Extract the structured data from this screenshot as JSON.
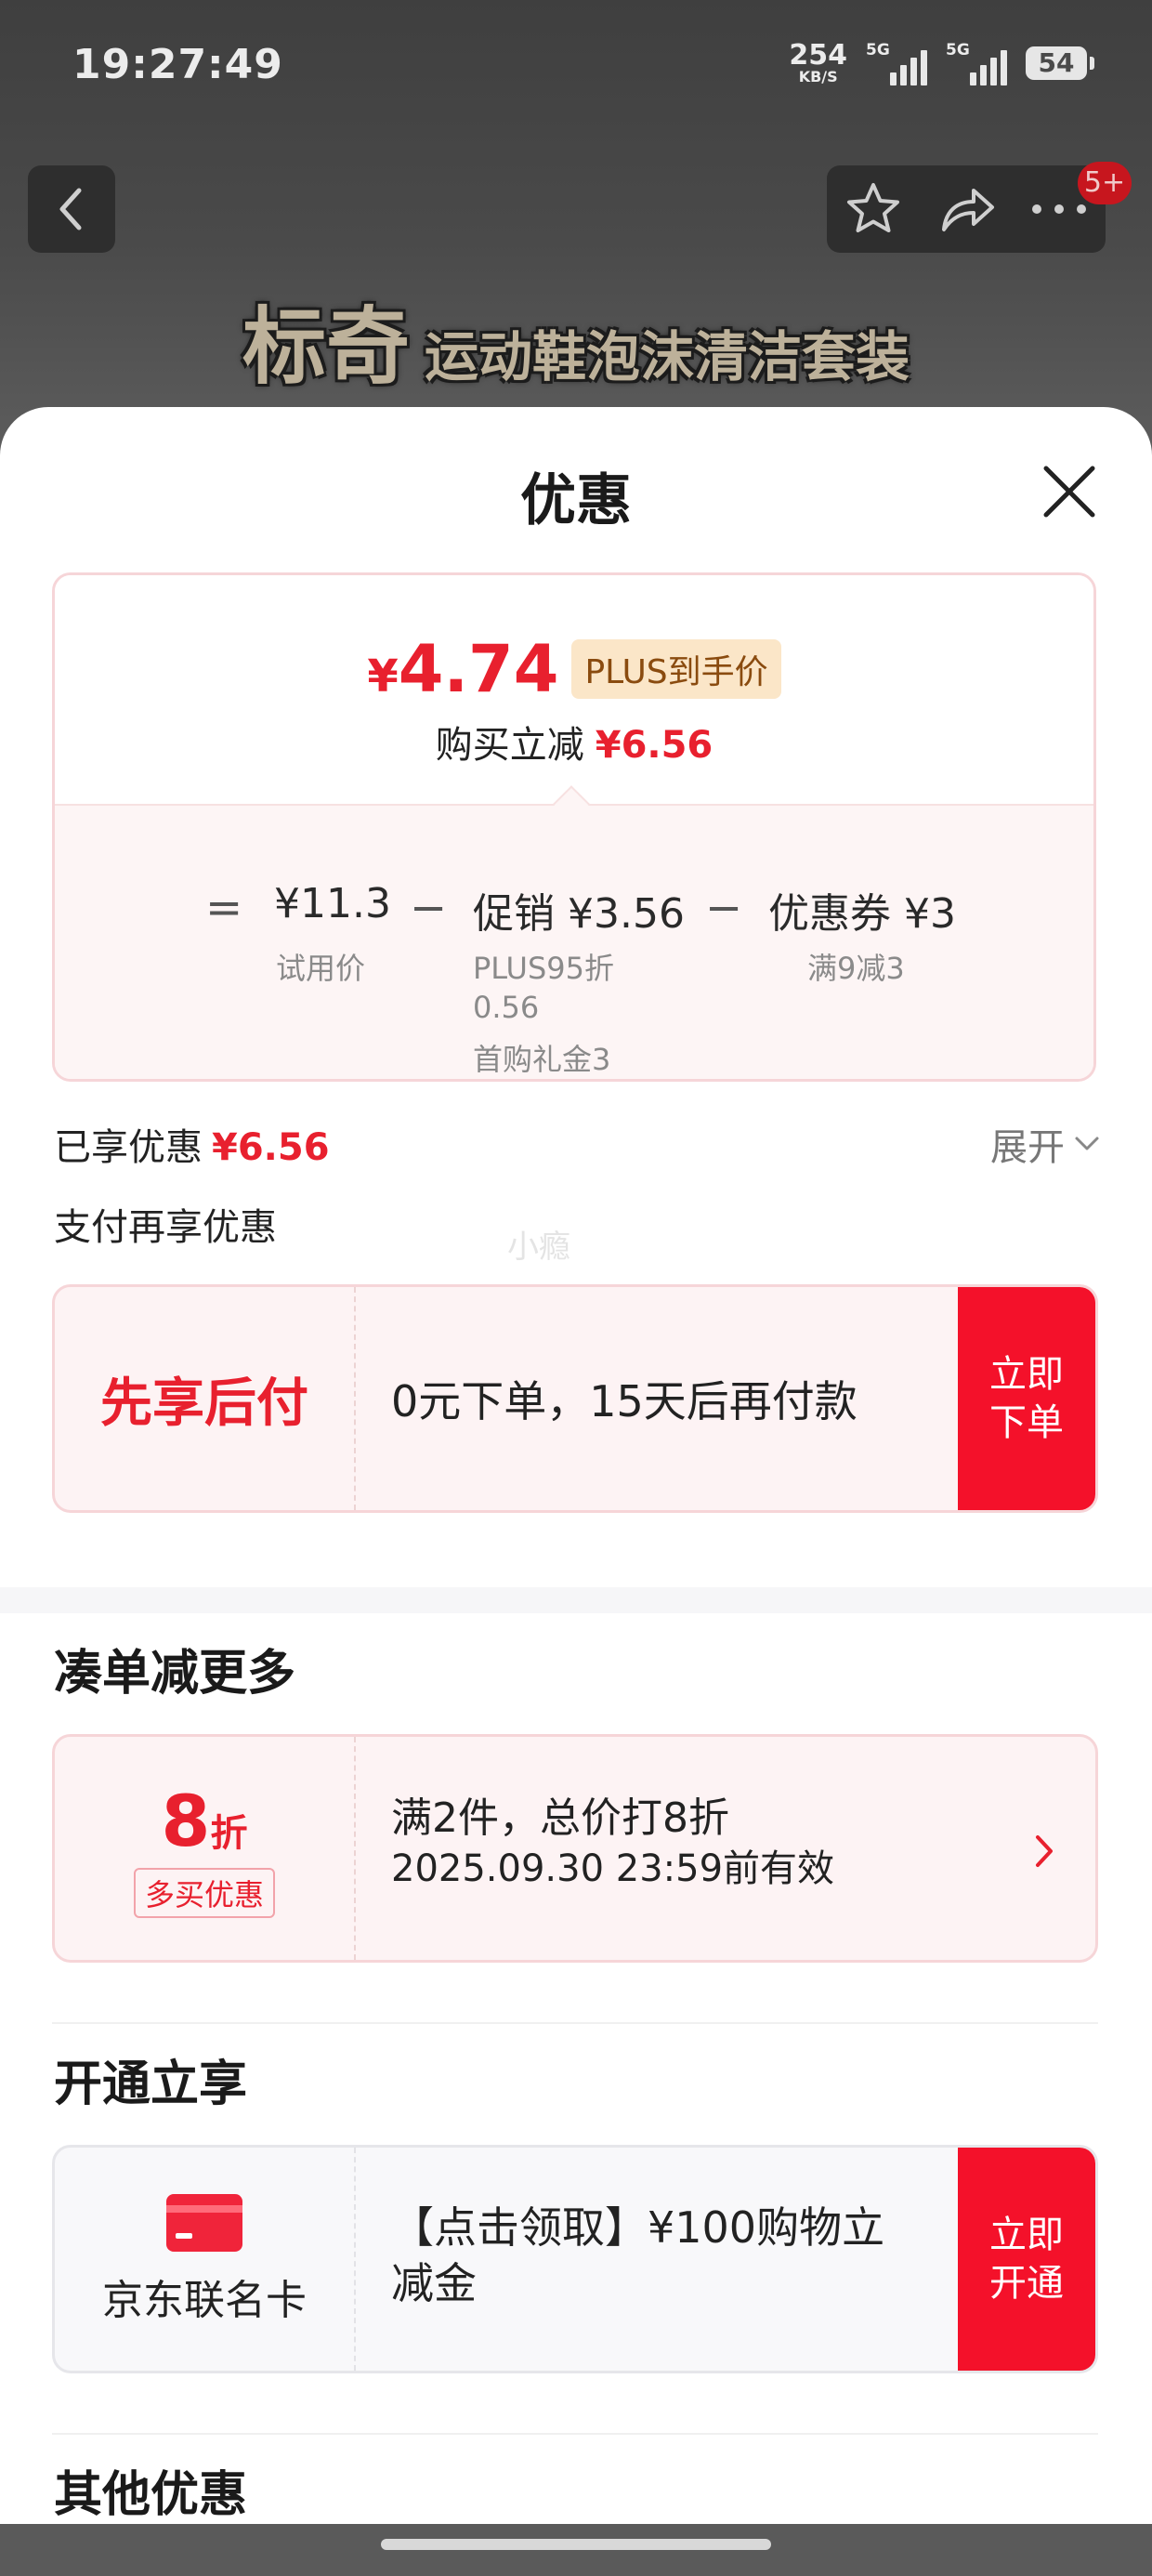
{
  "status_bar": {
    "time": "19:27:49",
    "net_speed_value": "254",
    "net_speed_unit": "KB/S",
    "signal1_tag": "5G",
    "signal2_tag": "5G",
    "battery": "54"
  },
  "header": {
    "message_badge": "5+",
    "banner_brand": "标奇",
    "banner_rest": "运动鞋泡沫清洁套装"
  },
  "sheet": {
    "title": "优惠",
    "final_price_currency": "¥",
    "final_price_value": "4.74",
    "plus_tag": "PLUS到手价",
    "instant_label": "购买立减",
    "instant_amount": "¥6.56",
    "calc": {
      "eq": "=",
      "trial_price": "¥11.3",
      "trial_label": "试用价",
      "minus1": "−",
      "promo": "促销 ¥3.56",
      "promo_sub1": "PLUS95折",
      "promo_sub2": "0.56",
      "promo_sub3": "首购礼金3",
      "minus2": "−",
      "coupon": "优惠券 ¥3",
      "coupon_sub": "满9减3"
    },
    "enjoyed_label": "已享优惠",
    "enjoyed_amount": "¥6.56",
    "expand_label": "展开",
    "pay_more_label": "支付再享优惠",
    "watermark": "小瘾",
    "bnpl": {
      "title": "先享后付",
      "desc": "0元下单，15天后再付款",
      "btn_line1": "立即",
      "btn_line2": "下单"
    },
    "bundle_section_title": "凑单减更多",
    "bundle": {
      "discount_num": "8",
      "discount_unit": "折",
      "tag": "多买优惠",
      "line1": "满2件，总价打8折",
      "line2": "2025.09.30 23:59前有效"
    },
    "open_section_title": "开通立享",
    "card_offer": {
      "name": "京东联名卡",
      "desc": "【点击领取】¥100购物立减金",
      "btn_line1": "立即",
      "btn_line2": "开通"
    },
    "other_section_title": "其他优惠"
  },
  "colors": {
    "accent_red": "#e8202e",
    "button_red": "#f4112a"
  }
}
